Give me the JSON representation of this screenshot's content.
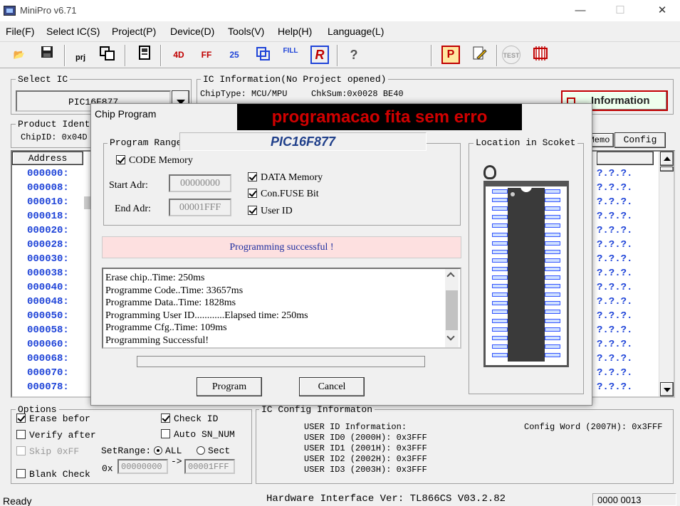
{
  "window": {
    "title": "MiniPro v6.71",
    "min": "—",
    "max": "☐",
    "close": "✕"
  },
  "menu": [
    "File(F)",
    "Select IC(S)",
    "Project(P)",
    "Device(D)",
    "Tools(V)",
    "Help(H)",
    "Language(L)"
  ],
  "toolbar": {
    "prj_label": "prj",
    "fill_label": "FILL",
    "r_label": "R",
    "p_label": "P",
    "test_label": "TEST",
    "d4_label": "4D",
    "ff_label": "FF",
    "n25_label": "25"
  },
  "select_ic": {
    "title": "Select IC",
    "value": "PIC16F877"
  },
  "ic_info": {
    "title": "IC Information(No Project opened)",
    "chip_type": "ChipType: MCU/MPU",
    "chksum": "ChkSum:0x0028 BE40",
    "info_button": "Information"
  },
  "product": {
    "title": "Product Identi",
    "chip_id": "ChipID: 0x04D"
  },
  "tabs": {
    "memo": "Memo",
    "config": "Config"
  },
  "address": {
    "header": "Address",
    "rows": [
      "000000:",
      "000008:",
      "000010:",
      "000018:",
      "000020:",
      "000028:",
      "000030:",
      "000038:",
      "000040:",
      "000048:",
      "000050:",
      "000058:",
      "000060:",
      "000068:",
      "000070:",
      "000078:"
    ],
    "right_text": "?.?.?."
  },
  "dialog": {
    "title": "Chip Program",
    "banner": "programacao fita sem erro",
    "chip_name": "PIC16F877",
    "range_title": "Program Range",
    "code_memory": "CODE Memory",
    "data_memory": "DATA Memory",
    "fuse_bit": "Con.FUSE Bit",
    "user_id": "User ID",
    "start_label": "Start Adr:",
    "start_value": "00000000",
    "end_label": "End Adr:",
    "end_value": "00001FFF",
    "status": "Programming successful !",
    "log": [
      "Erase chip..Time: 250ms",
      "Programme Code..Time: 33657ms",
      "Programme Data..Time: 1828ms",
      "Programming User ID............Elapsed time: 250ms",
      "Programme Cfg..Time: 109ms",
      "Programming Successful!"
    ],
    "program_button": "Program",
    "cancel_button": "Cancel",
    "location_title": "Location in Scoket",
    "progress": 0
  },
  "options": {
    "title": "Options",
    "erase": "Erase befor",
    "verify": "Verify after",
    "skip": "Skip 0xFF",
    "blank": "Blank Check",
    "check_id": "Check ID",
    "auto_sn": "Auto SN_NUM",
    "setrange": "SetRange:",
    "all": "ALL",
    "sect": "Sect",
    "ox": "0x",
    "from": "00000000",
    "arrow": "->",
    "to": "00001FFF"
  },
  "ic_config": {
    "title": "IC Config Informaton",
    "lines": [
      "USER ID Information:",
      "USER ID0 (2000H): 0x3FFF",
      "USER ID1 (2001H): 0x3FFF",
      "USER ID2 (2002H): 0x3FFF",
      "USER ID3 (2003H): 0x3FFF"
    ],
    "config_word": "Config Word (2007H): 0x3FFF"
  },
  "status_bar": {
    "left": "Ready",
    "center": "Hardware Interface Ver: TL866CS V03.2.82",
    "right": "0000 0013"
  }
}
